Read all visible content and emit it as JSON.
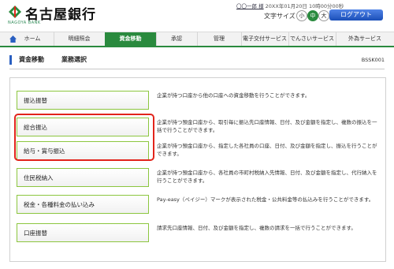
{
  "header": {
    "bank_name": "名古屋銀行",
    "bank_sub": "NAGOYA BANK",
    "user_name": "〇〇一郎 様",
    "last_login": "20XX年01月20日 10時00分00秒",
    "font_size_label": "文字サイズ",
    "font_sizes": [
      "小",
      "中",
      "大"
    ],
    "logout_label": "ログアウト"
  },
  "nav": {
    "items": [
      {
        "label": "ホーム",
        "icon": "home-icon"
      },
      {
        "label": "明細照会"
      },
      {
        "label": "資金移動"
      },
      {
        "label": "承認"
      },
      {
        "label": "管理"
      },
      {
        "label": "電子交付サービス"
      },
      {
        "label": "でんさいサービス"
      },
      {
        "label": "外為サービス"
      }
    ],
    "active_index": 2
  },
  "page": {
    "title": "資金移動",
    "subtitle": "業務選択",
    "screen_id": "BSSK001"
  },
  "menu": [
    {
      "label": "振込振替",
      "desc": "企業が持つ口座から他の口座への資金移動を行うことができます。"
    },
    {
      "label": "総合振込",
      "desc": "企業が持つ預金口座から、取引毎に振込先口座情報、日付、及び金額を指定し、複数の振込を一括で行うことができます。"
    },
    {
      "label": "給与・賞与振込",
      "desc": "企業が持つ預金口座から、指定した各社員の口座、日付、及び金額を指定し、振込を行うことができます。"
    },
    {
      "label": "住民税納入",
      "desc": "企業が持つ預金口座から、各社員の市町村税納入先情報、日付、及び金額を指定し、代行納入を行うことができます。"
    },
    {
      "label": "税金・各種料金の払い込み",
      "desc": "Pay-easy（ペイジー）マークが表示された税金・公共料金等の払込みを行うことができます。"
    },
    {
      "label": "口座振替",
      "desc": "請求先口座情報、日付、及び金額を指定し、複数の請求を一括で行うことができます。"
    }
  ],
  "colors": {
    "brand_green": "#2a8a3e",
    "button_border": "#8cc63f",
    "highlight_red": "#e2241b",
    "logout_blue": "#1b4fb8"
  }
}
